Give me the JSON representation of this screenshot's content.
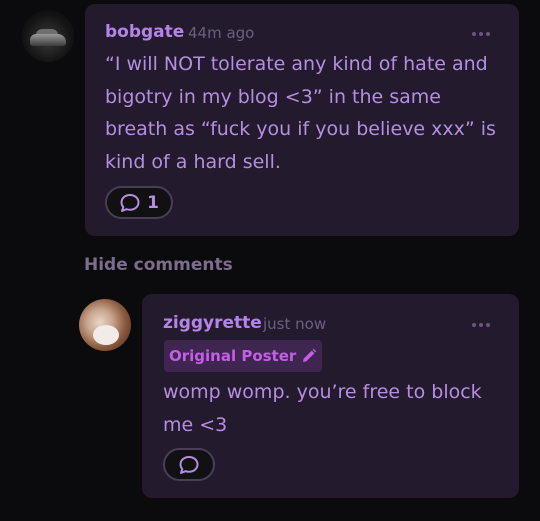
{
  "comments": [
    {
      "username": "bobgate",
      "time": "44m ago",
      "body": "“I will NOT tolerate any kind of hate and bigotry in my blog <3” in the same breath as “fuck you if you believe xxx” is kind of a hard sell.",
      "reply_count": "1",
      "reply_icon": "speech-bubble-icon"
    }
  ],
  "hide_comments_label": "Hide comments",
  "reply": {
    "username": "ziggyrette",
    "time": "just now",
    "badge_label": "Original Poster",
    "badge_icon": "pencil-icon",
    "body": "womp womp. you’re free to block me <3",
    "reply_icon": "speech-bubble-icon"
  },
  "colors": {
    "background": "#0b0a0c",
    "card": "#241a2e",
    "username": "#b484e6",
    "text": "#b58ee0",
    "badge_bg": "#3f2650",
    "badge_text": "#c65ce8"
  }
}
